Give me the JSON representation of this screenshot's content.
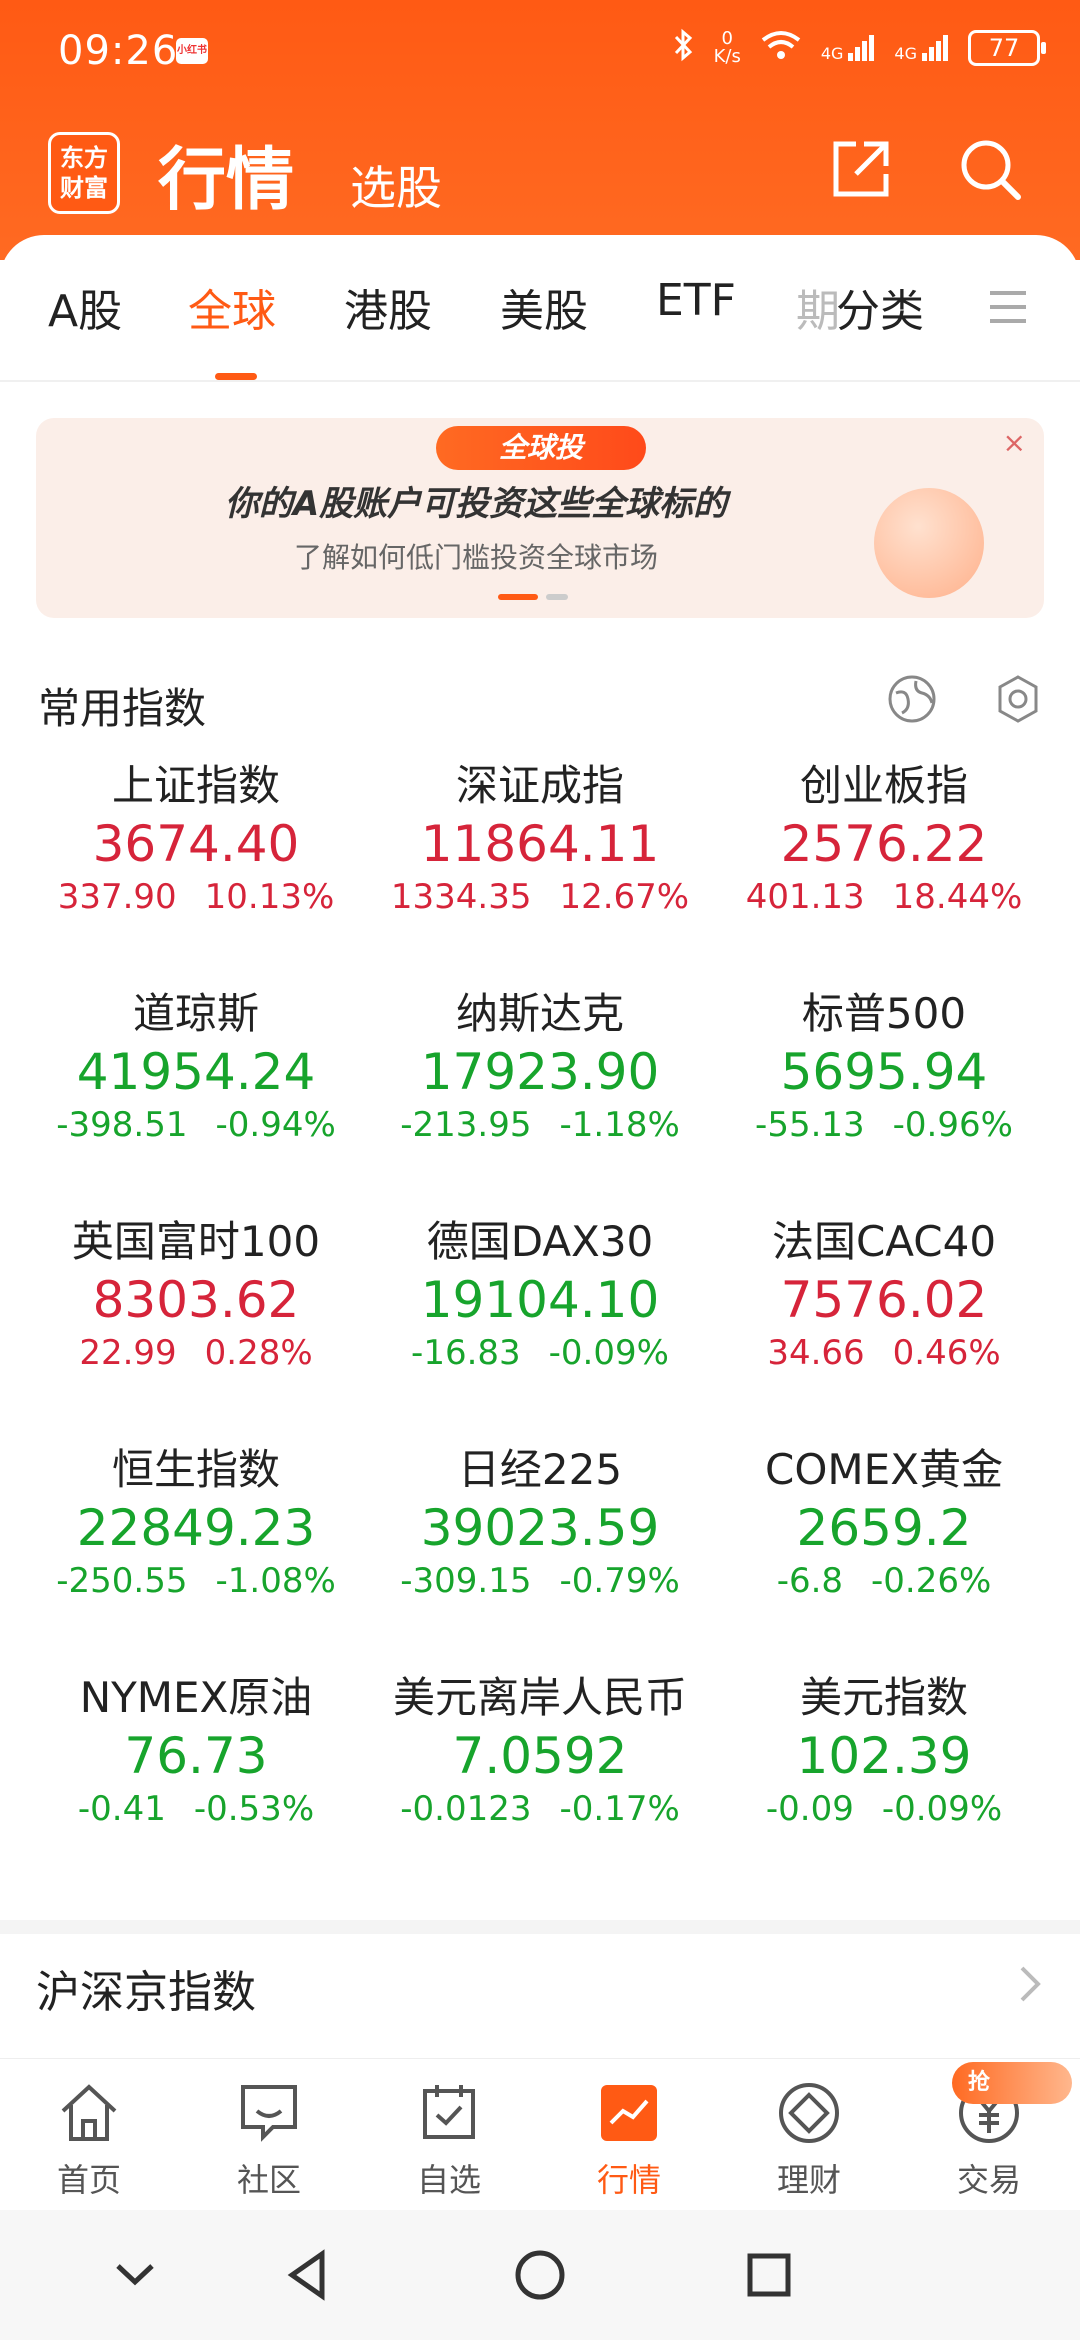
{
  "status_bar": {
    "time": "09:26",
    "app_badge": "小红书",
    "network_speed_value": "0",
    "network_speed_unit": "K/s",
    "signal1": "4G",
    "signal2": "4G",
    "battery": "77"
  },
  "header": {
    "logo_line1": "东方",
    "logo_line2": "财富",
    "title": "行情",
    "subtitle": "选股"
  },
  "tabs": [
    {
      "label": "A股"
    },
    {
      "label": "全球"
    },
    {
      "label": "港股"
    },
    {
      "label": "美股"
    },
    {
      "label": "ETF"
    },
    {
      "label": "期"
    },
    {
      "label": "分类"
    }
  ],
  "active_tab": "全球",
  "banner": {
    "tag": "全球投",
    "title": "你的A股账户可投资这些全球标的",
    "subtitle": "了解如何低门槛投资全球市场",
    "close": "×"
  },
  "section": {
    "title": "常用指数"
  },
  "indices": [
    {
      "name": "上证指数",
      "price": "3674.40",
      "change": "337.90",
      "pct": "10.13%",
      "dir": "up"
    },
    {
      "name": "深证成指",
      "price": "11864.11",
      "change": "1334.35",
      "pct": "12.67%",
      "dir": "up"
    },
    {
      "name": "创业板指",
      "price": "2576.22",
      "change": "401.13",
      "pct": "18.44%",
      "dir": "up"
    },
    {
      "name": "道琼斯",
      "price": "41954.24",
      "change": "-398.51",
      "pct": "-0.94%",
      "dir": "down"
    },
    {
      "name": "纳斯达克",
      "price": "17923.90",
      "change": "-213.95",
      "pct": "-1.18%",
      "dir": "down"
    },
    {
      "name": "标普500",
      "price": "5695.94",
      "change": "-55.13",
      "pct": "-0.96%",
      "dir": "down"
    },
    {
      "name": "英国富时100",
      "price": "8303.62",
      "change": "22.99",
      "pct": "0.28%",
      "dir": "up"
    },
    {
      "name": "德国DAX30",
      "price": "19104.10",
      "change": "-16.83",
      "pct": "-0.09%",
      "dir": "down"
    },
    {
      "name": "法国CAC40",
      "price": "7576.02",
      "change": "34.66",
      "pct": "0.46%",
      "dir": "up"
    },
    {
      "name": "恒生指数",
      "price": "22849.23",
      "change": "-250.55",
      "pct": "-1.08%",
      "dir": "down"
    },
    {
      "name": "日经225",
      "price": "39023.59",
      "change": "-309.15",
      "pct": "-0.79%",
      "dir": "down"
    },
    {
      "name": "COMEX黄金",
      "price": "2659.2",
      "change": "-6.8",
      "pct": "-0.26%",
      "dir": "down"
    },
    {
      "name": "NYMEX原油",
      "price": "76.73",
      "change": "-0.41",
      "pct": "-0.53%",
      "dir": "down"
    },
    {
      "name": "美元离岸人民币",
      "price": "7.0592",
      "change": "-0.0123",
      "pct": "-0.17%",
      "dir": "down"
    },
    {
      "name": "美元指数",
      "price": "102.39",
      "change": "-0.09",
      "pct": "-0.09%",
      "dir": "down"
    }
  ],
  "next_section": {
    "title": "沪深京指数"
  },
  "bottom_nav": [
    {
      "label": "首页",
      "icon": "home-icon"
    },
    {
      "label": "社区",
      "icon": "chat-icon"
    },
    {
      "label": "自选",
      "icon": "calendar-check-icon"
    },
    {
      "label": "行情",
      "icon": "chart-icon"
    },
    {
      "label": "理财",
      "icon": "diamond-icon"
    },
    {
      "label": "交易",
      "icon": "yuan-icon"
    }
  ],
  "promo_badge": "抢",
  "colors": {
    "brand": "#ff5a14",
    "up": "#d6243a",
    "down": "#17a42c"
  }
}
